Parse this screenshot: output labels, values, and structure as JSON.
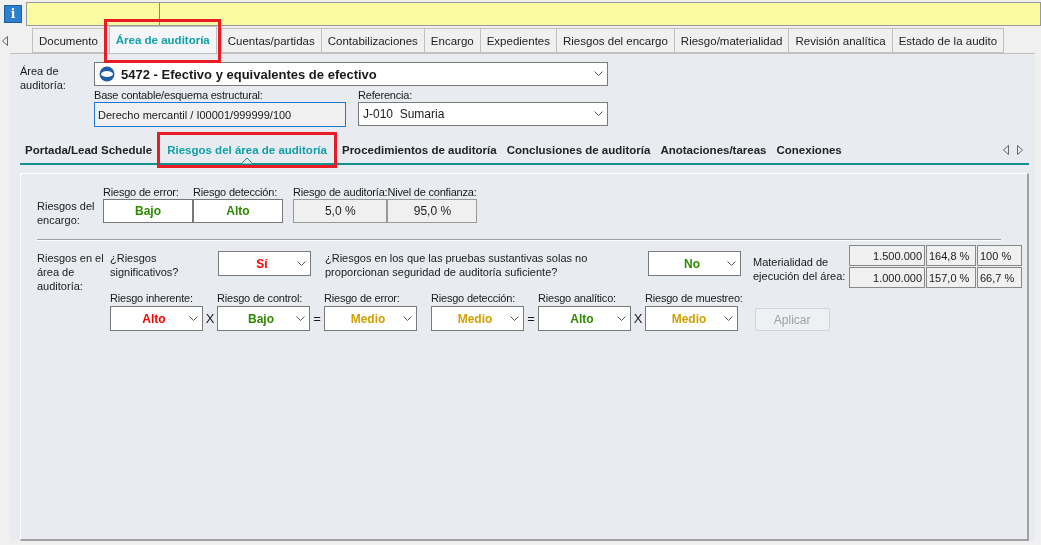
{
  "info_icon": "i",
  "tabs": [
    {
      "label": "Documento",
      "selected": false,
      "highlighted": false
    },
    {
      "label": "Área de auditoría",
      "selected": true,
      "highlighted": true
    },
    {
      "label": "Cuentas/partidas",
      "selected": false,
      "highlighted": false
    },
    {
      "label": "Contabilizaciones",
      "selected": false,
      "highlighted": false
    },
    {
      "label": "Encargo",
      "selected": false,
      "highlighted": false
    },
    {
      "label": "Expedientes",
      "selected": false,
      "highlighted": false
    },
    {
      "label": "Riesgos del encargo",
      "selected": false,
      "highlighted": false
    },
    {
      "label": "Riesgo/materialidad",
      "selected": false,
      "highlighted": false
    },
    {
      "label": "Revisión analítica",
      "selected": false,
      "highlighted": false
    },
    {
      "label": "Estado de la audito",
      "selected": false,
      "highlighted": false
    }
  ],
  "area": {
    "label": "Área de auditoría:",
    "value": "5472 - Efectivo y equivalentes de efectivo"
  },
  "base": {
    "label": "Base contable/esquema estructural:",
    "value": "Derecho mercantil / I00001/999999/100"
  },
  "referencia": {
    "label": "Referencia:",
    "value": "J-010  Sumaria"
  },
  "subtabs": [
    {
      "label": "Portada/Lead Schedule",
      "selected": false,
      "highlighted": false
    },
    {
      "label": "Riesgos del área de auditoría",
      "selected": true,
      "highlighted": true
    },
    {
      "label": "Procedimientos de auditoría",
      "selected": false,
      "highlighted": false
    },
    {
      "label": "Conclusiones de auditoría",
      "selected": false,
      "highlighted": false
    },
    {
      "label": "Anotaciones/tareas",
      "selected": false,
      "highlighted": false
    },
    {
      "label": "Conexiones",
      "selected": false,
      "highlighted": false
    }
  ],
  "engagement_risks": {
    "label": "Riesgos del encargo:",
    "fields": [
      {
        "kind": "rating",
        "label": "Riesgo de error:",
        "value": "Bajo",
        "color": "#2e8b00"
      },
      {
        "kind": "rating",
        "label": "Riesgo detección:",
        "value": "Alto",
        "color": "#2e8b00"
      },
      {
        "kind": "readonly",
        "label": "Riesgo de auditoría:",
        "value": "5,0 %"
      },
      {
        "kind": "readonly",
        "label": "Nivel de confianza:",
        "value": "95,0 %"
      }
    ]
  },
  "area_risks": {
    "label": "Riesgos en el área de auditoría:",
    "significant": {
      "label": "¿Riesgos significativos?",
      "value": "Sí",
      "color": "#ff0000"
    },
    "substantive": {
      "label": "¿Riesgos en los que las pruebas sustantivas solas no proporcionan seguridad de auditoría suficiente?",
      "value": "No",
      "color": "#2e8b00"
    },
    "materiality": {
      "label": "Materialidad de ejecución del área:",
      "rows": [
        [
          "1.500.000",
          "164,8 %",
          "100 %"
        ],
        [
          "1.000.000",
          "157,0 %",
          "66,7 %"
        ]
      ]
    },
    "chain": [
      {
        "label": "Riesgo inherente:",
        "value": "Alto",
        "color": "#ff0000"
      },
      {
        "label": "Riesgo de control:",
        "value": "Bajo",
        "color": "#2e8b00",
        "operator": "X"
      },
      {
        "label": "Riesgo de error:",
        "value": "Medio",
        "color": "#d4a000",
        "operator": "="
      },
      {
        "label": "Riesgo detección:",
        "value": "Medio",
        "color": "#d4a000"
      },
      {
        "label": "Riesgo analítico:",
        "value": "Alto",
        "color": "#2e8b00",
        "operator": "="
      },
      {
        "label": "Riesgo de muestreo:",
        "value": "Medio",
        "color": "#d4a000",
        "operator": "X"
      }
    ],
    "apply_button": {
      "label": "Aplicar",
      "disabled": true
    }
  }
}
